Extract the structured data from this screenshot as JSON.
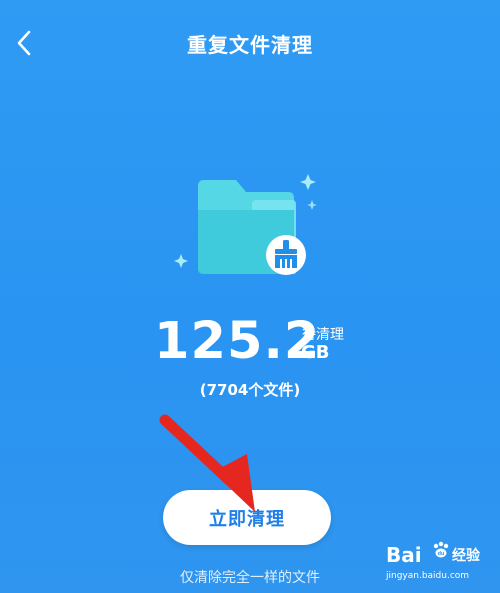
{
  "header": {
    "back_icon": "chevron-left-icon",
    "title": "重复文件清理"
  },
  "illustration": {
    "icon": "folder-broom-icon"
  },
  "summary": {
    "value": "125.2",
    "status": "待清理",
    "unit": "GB",
    "file_count": "(7704个文件)"
  },
  "actions": {
    "clean_label": "立即清理",
    "hint": "仅清除完全一样的文件"
  },
  "annotation": {
    "arrow_color": "#e5271f"
  },
  "watermark": {
    "brand": "Bai",
    "paw_text": "du",
    "jingyan": "经验",
    "url": "jingyan.baidu.com"
  },
  "colors": {
    "background": "#2a94f2",
    "button_text": "#1f7fe9"
  }
}
